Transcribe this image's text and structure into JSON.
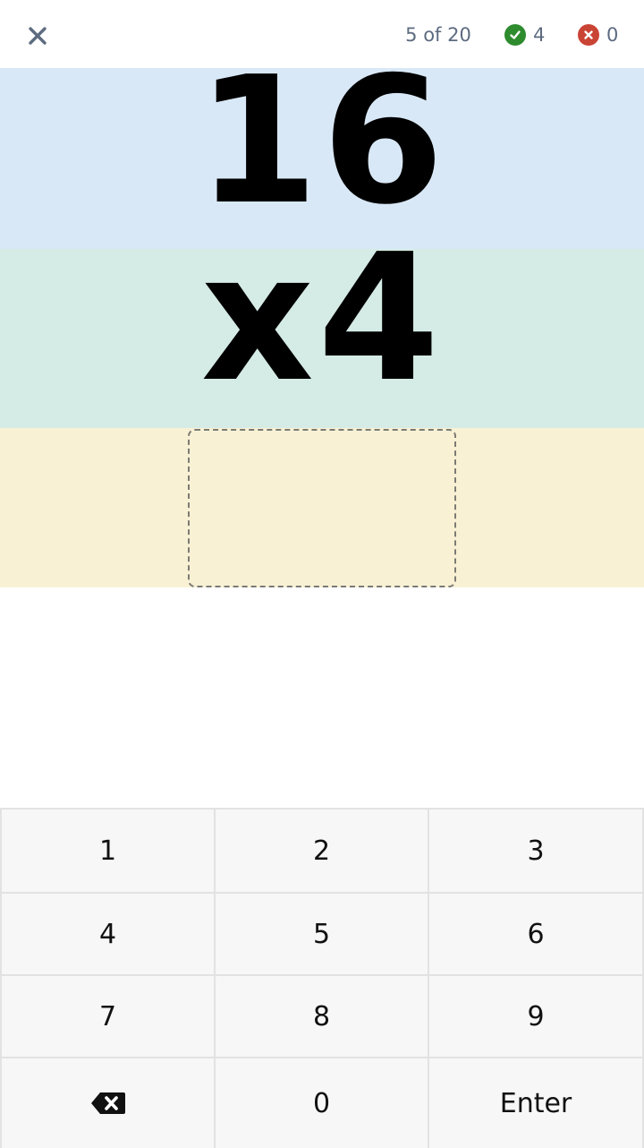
{
  "header": {
    "progress": "5 of 20",
    "correct_count": "4",
    "wrong_count": "0",
    "colors": {
      "correct": "#2e8b2e",
      "wrong": "#c94435",
      "text": "#5d6b80"
    }
  },
  "problem": {
    "operand": "16",
    "operation": "x4",
    "answer": ""
  },
  "keypad": {
    "keys": [
      "1",
      "2",
      "3",
      "4",
      "5",
      "6",
      "7",
      "8",
      "9"
    ],
    "zero": "0",
    "enter": "Enter",
    "backspace_icon": "backspace-icon"
  }
}
